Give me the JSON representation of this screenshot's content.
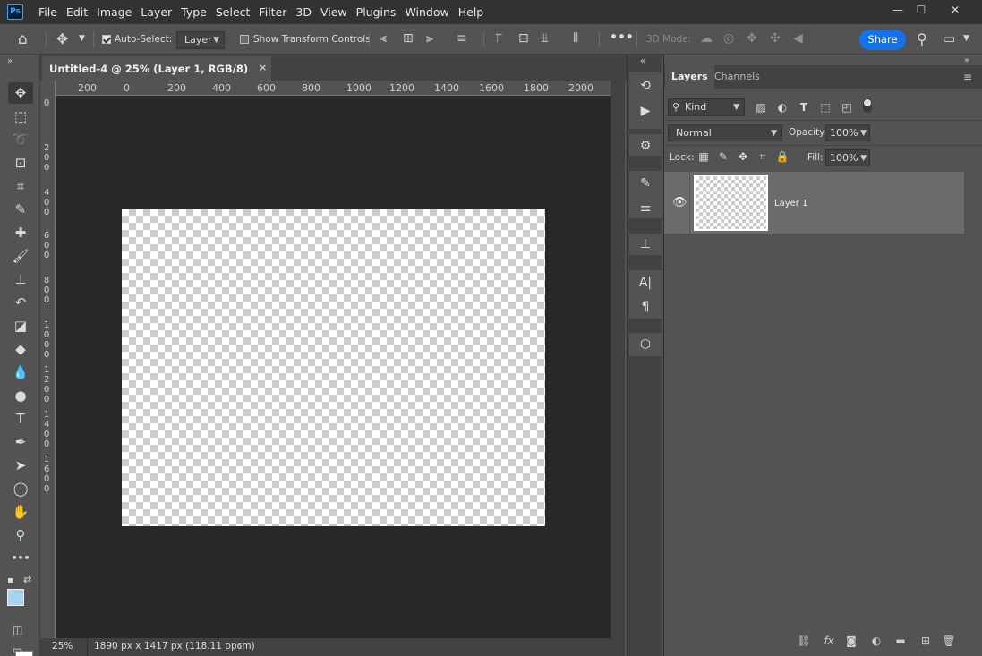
{
  "menubar": {
    "logo": "Ps",
    "items": [
      "File",
      "Edit",
      "Image",
      "Layer",
      "Type",
      "Select",
      "Filter",
      "3D",
      "View",
      "Plugins",
      "Window",
      "Help"
    ]
  },
  "options": {
    "auto_select_label": "Auto-Select:",
    "auto_select_checked": true,
    "auto_select_target": "Layer",
    "show_transform_label": "Show Transform Controls",
    "show_transform_checked": false,
    "mode_3d_label": "3D Mode:",
    "share_label": "Share",
    "share_color": "#1473e6"
  },
  "document": {
    "tab_title": "Untitled-4 @ 25% (Layer 1, RGB/8)",
    "close_glyph": "×",
    "ruler_top_labels": [
      "200",
      "0",
      "200",
      "400",
      "600",
      "800",
      "1000",
      "1200",
      "1400",
      "1600",
      "1800",
      "2000"
    ],
    "ruler_left_labels": [
      "0",
      "2 0 0",
      "4 0 0",
      "6 0 0",
      "8 0 0",
      "1 0 0 0",
      "1 2 0 0",
      "1 4 0 0",
      "1 6 0 0"
    ]
  },
  "status": {
    "zoom": "25%",
    "dimensions": "1890 px x 1417 px (118.11 ppcm)",
    "arrow": "›"
  },
  "toolbar": {
    "tools": [
      {
        "name": "move-tool",
        "glyph": "✥",
        "active": true
      },
      {
        "name": "rect-marquee-tool",
        "glyph": "⬚"
      },
      {
        "name": "lasso-tool",
        "glyph": "➰"
      },
      {
        "name": "object-select-tool",
        "glyph": "⊡"
      },
      {
        "name": "crop-tool",
        "glyph": "⌗"
      },
      {
        "name": "eyedropper-tool",
        "glyph": "✎"
      },
      {
        "name": "healing-brush-tool",
        "glyph": "✚"
      },
      {
        "name": "brush-tool",
        "glyph": "🖌"
      },
      {
        "name": "clone-stamp-tool",
        "glyph": "⊥"
      },
      {
        "name": "history-brush-tool",
        "glyph": "↶"
      },
      {
        "name": "eraser-tool",
        "glyph": "◪"
      },
      {
        "name": "paint-bucket-tool",
        "glyph": "◆"
      },
      {
        "name": "blur-tool",
        "glyph": "💧"
      },
      {
        "name": "dodge-tool",
        "glyph": "●"
      },
      {
        "name": "type-tool",
        "glyph": "T"
      },
      {
        "name": "pen-tool",
        "glyph": "✒"
      },
      {
        "name": "path-select-tool",
        "glyph": "➤"
      },
      {
        "name": "ellipse-tool",
        "glyph": "◯"
      },
      {
        "name": "hand-tool",
        "glyph": "✋"
      },
      {
        "name": "zoom-tool",
        "glyph": "⚲"
      },
      {
        "name": "more-tools",
        "glyph": "•••"
      }
    ],
    "foreground_color": "#a7d3f0",
    "background_color": "#ffffff"
  },
  "layers_panel": {
    "tabs": [
      "Layers",
      "Channels"
    ],
    "filter_kind": "Kind",
    "blend_mode": "Normal",
    "opacity_label": "Opacity:",
    "opacity_value": "100%",
    "lock_label": "Lock:",
    "fill_label": "Fill:",
    "fill_value": "100%",
    "layers": [
      {
        "name": "Layer 1",
        "visible": true,
        "selected": true
      }
    ]
  }
}
